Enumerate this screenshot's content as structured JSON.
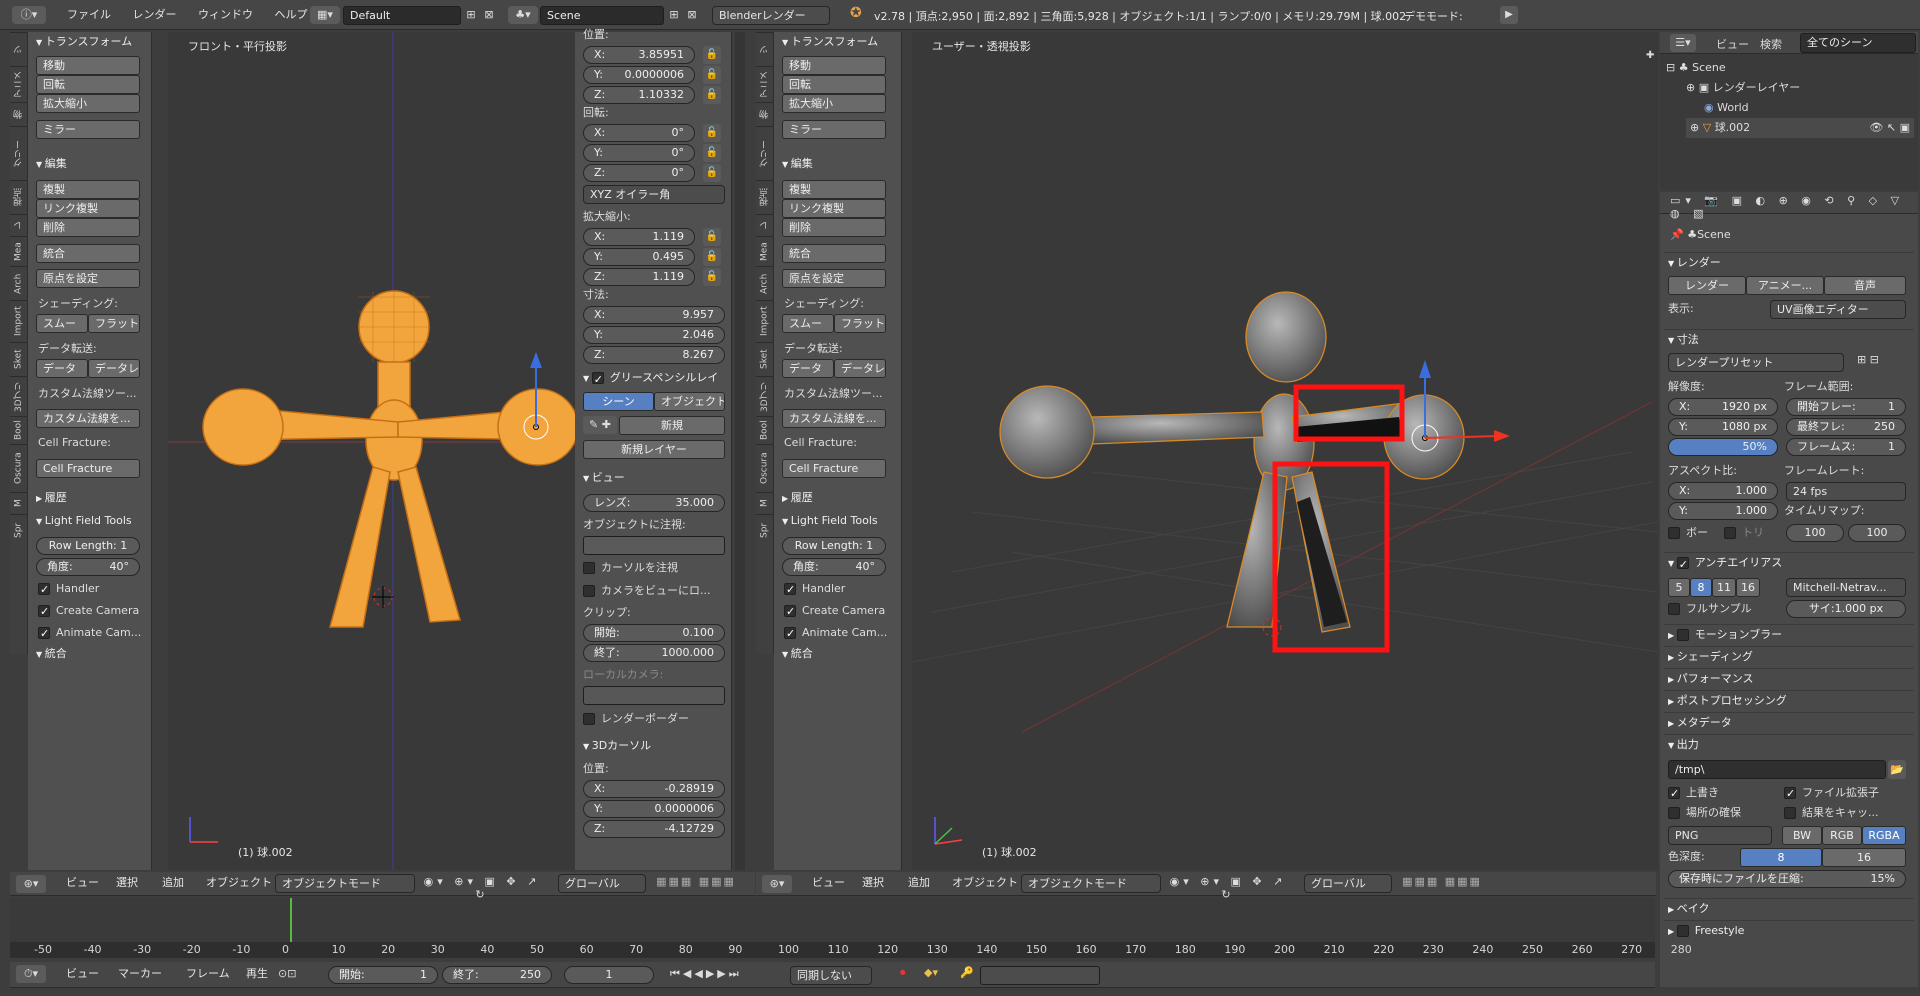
{
  "topbar": {
    "menus": [
      "ファイル",
      "レンダー",
      "ウィンドウ",
      "ヘルプ"
    ],
    "layout": "Default",
    "scene": "Scene",
    "engine": "Blenderレンダー",
    "stats": "v2.78 | 頂点:2,950 | 面:2,892 | 三角面:5,928 | オブジェクト:1/1 | ランプ:0/0 | メモリ:29.79M | 球.002",
    "mode": "デモモード:"
  },
  "tool_tabs": [
    "ツ",
    "アニメ",
    "物",
    "グリー",
    "視点",
    "レ",
    "Mea",
    "Arch",
    "Import",
    "Sket",
    "3Dプリ",
    "Bool",
    "Oscura",
    "M",
    "Spr"
  ],
  "tools": {
    "transform": "トランスフォーム",
    "move": "移動",
    "rotate": "回転",
    "scale": "拡大縮小",
    "mirror": "ミラー",
    "edit": "編集",
    "duplicate": "複製",
    "linked_dup": "リンク複製",
    "delete": "削除",
    "join": "統合",
    "set_origin": "原点を設定",
    "shading": "シェーディング:",
    "smooth": "スムー",
    "flat": "フラット",
    "data_transfer": "データ転送:",
    "data": "データ",
    "data_layout": "データレ",
    "custom_normal_tools": "カスタム法線ツー...",
    "custom_normal_set": "カスタム法線を...",
    "cell_fracture_lbl": "Cell Fracture:",
    "cell_fracture_btn": "Cell Fracture",
    "history": "履歴",
    "lft": "Light Field Tools",
    "row_length": "Row Length: 1",
    "angle_label": "角度:",
    "angle_value": "40°",
    "handler": "Handler",
    "create_camera": "Create Camera",
    "animate_cam": "Animate Cam...",
    "animate_cam_r": "Animate Cam...",
    "join_sec": "統合",
    "custom_normal_tools_r": "カスタム法線ツー...",
    "custom_normal_set_r": "カスタム法線を..."
  },
  "left_view": {
    "label": "フロント・平行投影",
    "object": "(1) 球.002"
  },
  "right_view": {
    "label": "ユーザー・透視投影",
    "object": "(1) 球.002"
  },
  "props": {
    "location": "位置:",
    "loc": [
      {
        "a": "X:",
        "v": "3.85951"
      },
      {
        "a": "Y:",
        "v": "0.0000006"
      },
      {
        "a": "Z:",
        "v": "1.10332"
      }
    ],
    "rotation": "回転:",
    "rot": [
      {
        "a": "X:",
        "v": "0°"
      },
      {
        "a": "Y:",
        "v": "0°"
      },
      {
        "a": "Z:",
        "v": "0°"
      }
    ],
    "rot_mode": "XYZ オイラー角",
    "scale": "拡大縮小:",
    "scl": [
      {
        "a": "X:",
        "v": "1.119"
      },
      {
        "a": "Y:",
        "v": "0.495"
      },
      {
        "a": "Z:",
        "v": "1.119"
      }
    ],
    "dimensions": "寸法:",
    "dim": [
      {
        "a": "X:",
        "v": "9.957"
      },
      {
        "a": "Y:",
        "v": "2.046"
      },
      {
        "a": "Z:",
        "v": "8.267"
      }
    ],
    "grease": "グリースペンシルレイ",
    "scene_btn": "シーン",
    "object_btn": "オブジェクト",
    "new": "新規",
    "new_layer": "新規レイヤー",
    "view": "ビュー",
    "lens_a": "レンズ:",
    "lens_v": "35.000",
    "lock_to_object": "オブジェクトに注視:",
    "lock_cursor": "カーソルを注視",
    "lock_camera": "カメラをビューにロ...",
    "clip": "クリップ:",
    "clip_start_a": "開始:",
    "clip_start_v": "0.100",
    "clip_end_a": "終了:",
    "clip_end_v": "1000.000",
    "local_camera": "ローカルカメラ:",
    "render_border": "レンダーボーダー",
    "cursor3d": "3Dカーソル",
    "cursor_loc": "位置:",
    "cur": [
      {
        "a": "X:",
        "v": "-0.28919"
      },
      {
        "a": "Y:",
        "v": "0.0000006"
      },
      {
        "a": "Z:",
        "v": "-4.12729"
      }
    ]
  },
  "vp_header": {
    "view": "ビュー",
    "select": "選択",
    "add": "追加",
    "object": "オブジェクト",
    "mode": "オブジェクトモード",
    "global": "グローバル"
  },
  "outliner": {
    "view": "ビュー",
    "search": "検索",
    "all_scenes": "全てのシーン",
    "items": [
      "Scene",
      "レンダーレイヤー",
      "World",
      "球.002"
    ]
  },
  "render": {
    "scene": "Scene",
    "render_sec": "レンダー",
    "render_btn": "レンダー",
    "anim_btn": "アニメー...",
    "audio_btn": "音声",
    "display_a": "表示:",
    "display_v": "UV画像エディター",
    "dimensions": "寸法",
    "preset": "レンダープリセット",
    "resolution": "解像度:",
    "res_x_a": "X:",
    "res_x_v": "1920 px",
    "res_y_a": "Y:",
    "res_y_v": "1080 px",
    "res_pct": "50%",
    "frame_range": "フレーム範囲:",
    "start_a": "開始フレー:",
    "start_v": "1",
    "end_a": "最終フレ:",
    "end_v": "250",
    "step_a": "フレームス:",
    "step_v": "1",
    "aspect": "アスペクト比:",
    "asp_x_a": "X:",
    "asp_x_v": "1.000",
    "asp_y_a": "Y:",
    "asp_y_v": "1.000",
    "framerate": "フレームレート:",
    "fps": "24 fps",
    "time_remap": "タイムリマップ:",
    "border": "ボー",
    "crop": "トリ",
    "remap_old": "100",
    "remap_new": "100",
    "aa": "アンチエイリアス",
    "aa_5": "5",
    "aa_8": "8",
    "aa_11": "11",
    "aa_16": "16",
    "aa_filter": "Mitchell-Netrav...",
    "full_sample": "フルサンプル",
    "filter_size": "サイ:1.000 px",
    "motion_blur": "モーションブラー",
    "shading": "シェーディング",
    "performance": "パフォーマンス",
    "post": "ポストプロセッシング",
    "metadata": "メタデータ",
    "output": "出力",
    "path": "/tmp\\",
    "overwrite": "上書き",
    "file_ext": "ファイル拡張子",
    "placeholders": "場所の確保",
    "cache": "結果をキャッ...",
    "format": "PNG",
    "bw": "BW",
    "rgb": "RGB",
    "rgba": "RGBA",
    "depth_a": "色深度:",
    "depth_8": "8",
    "depth_16": "16",
    "compress": "保存時にファイルを圧縮:",
    "compress_v": "15%",
    "bake": "ベイク",
    "freestyle": "Freestyle"
  },
  "timeline": {
    "ticks": [
      "-50",
      "-40",
      "-30",
      "-20",
      "-10",
      "0",
      "10",
      "20",
      "30",
      "40",
      "50",
      "60",
      "70",
      "80",
      "90",
      "100",
      "110",
      "120",
      "130",
      "140",
      "150",
      "160",
      "170",
      "180",
      "190",
      "200",
      "210",
      "220",
      "230",
      "240",
      "250",
      "260",
      "270",
      "280"
    ],
    "view": "ビュー",
    "marker": "マーカー",
    "frame": "フレーム",
    "playback": "再生",
    "start_a": "開始:",
    "start_v": "1",
    "end_a": "終了:",
    "end_v": "250",
    "current": "1",
    "sync": "同期しない"
  }
}
